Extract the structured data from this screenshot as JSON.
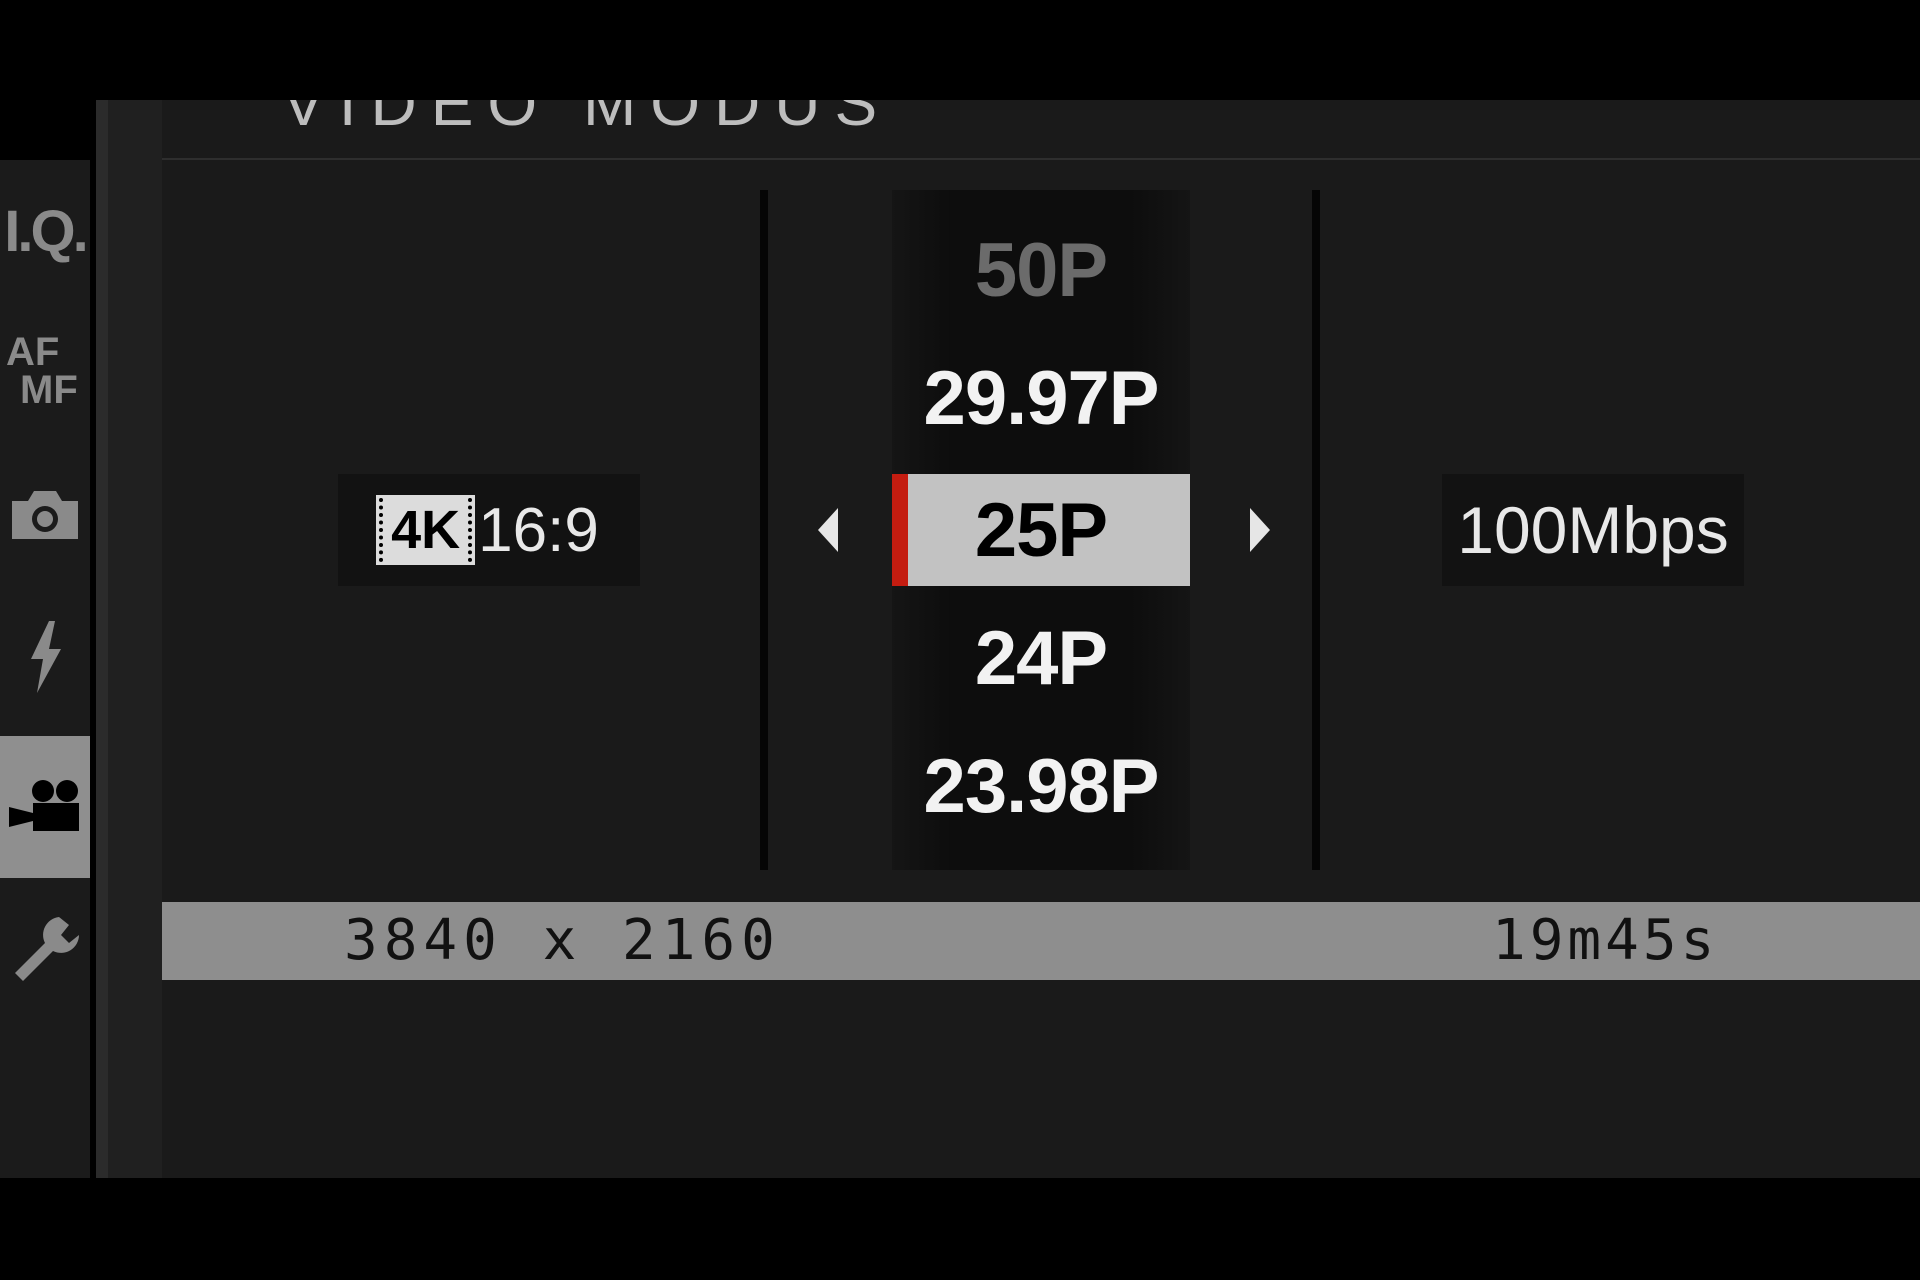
{
  "title": "VIDEO MODUS",
  "sidebar": {
    "items": [
      {
        "label": "I.Q.",
        "icon": "image-quality-icon"
      },
      {
        "label_top": "AF",
        "label_bottom": "MF",
        "icon": "af-mf-icon"
      },
      {
        "label": "",
        "icon": "camera-icon"
      },
      {
        "label": "",
        "icon": "flash-icon"
      },
      {
        "label": "",
        "icon": "movie-camera-icon",
        "active": true
      },
      {
        "label": "",
        "icon": "wrench-icon"
      }
    ]
  },
  "resolution": {
    "badge": "4K",
    "ratio": "16:9"
  },
  "frame_rates": {
    "items": [
      "50P",
      "29.97P",
      "25P",
      "24P",
      "23.98P"
    ],
    "selected": "25P"
  },
  "bitrate": "100Mbps",
  "info_bar": {
    "dimensions": "3840 x 2160",
    "remaining_time": "19m45s"
  },
  "colors": {
    "selection_marker": "#c41c10",
    "selected_bg": "#c2c2c2",
    "info_bar_bg": "#8e8e8e"
  }
}
